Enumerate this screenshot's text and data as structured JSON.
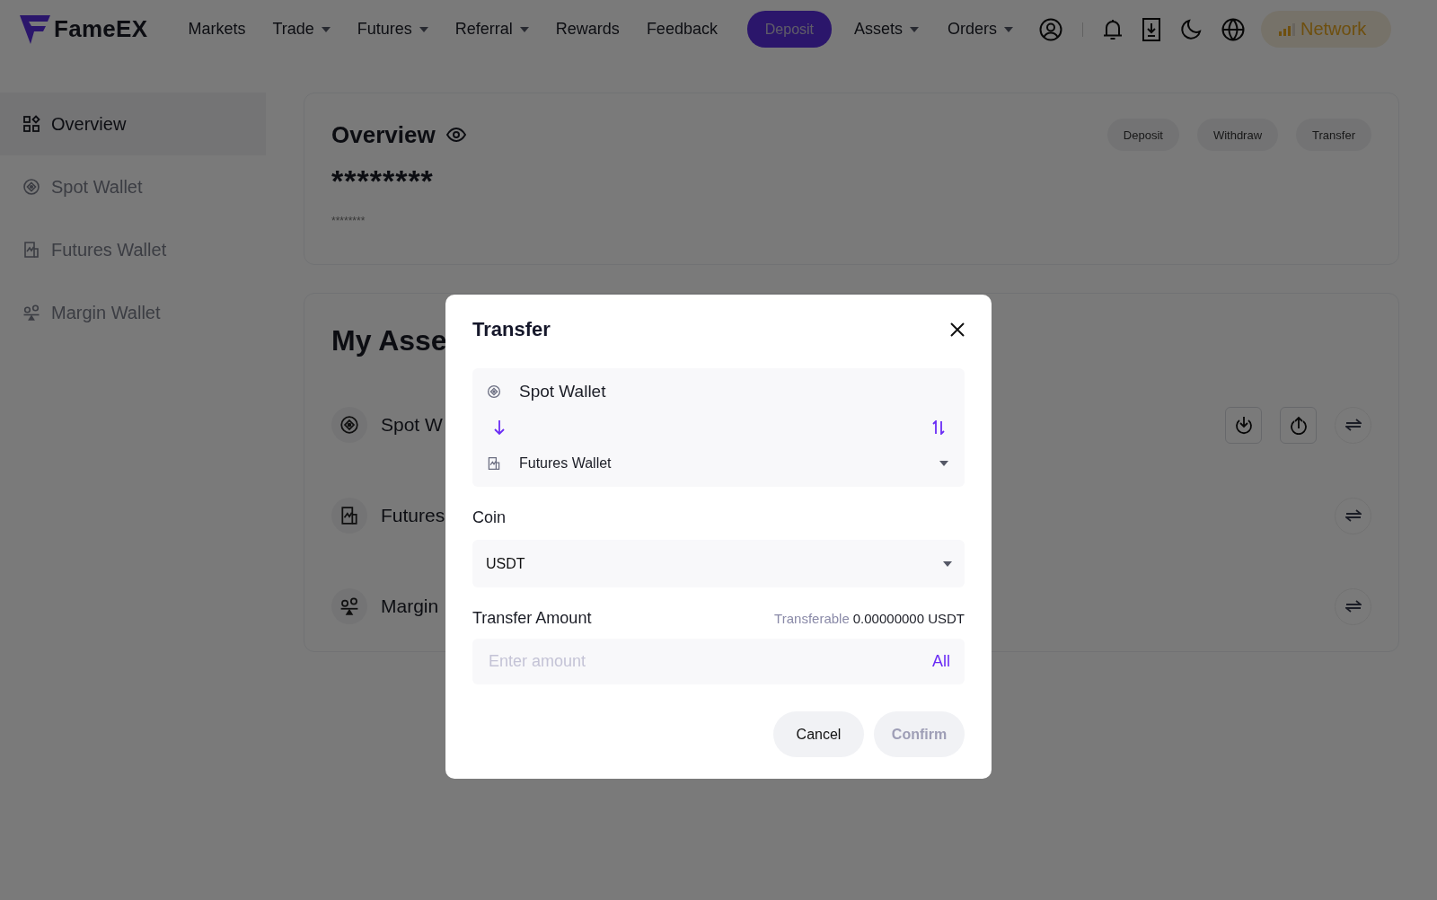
{
  "header": {
    "logo": "FameEX",
    "nav": [
      {
        "label": "Markets",
        "dropdown": false
      },
      {
        "label": "Trade",
        "dropdown": true
      },
      {
        "label": "Futures",
        "dropdown": true
      },
      {
        "label": "Referral",
        "dropdown": true
      },
      {
        "label": "Rewards",
        "dropdown": false
      },
      {
        "label": "Feedback",
        "dropdown": false
      }
    ],
    "deposit_button": "Deposit",
    "menus": [
      {
        "label": "Assets",
        "dropdown": true
      },
      {
        "label": "Orders",
        "dropdown": true
      }
    ],
    "network": "Network"
  },
  "sidebar": {
    "items": [
      {
        "label": "Overview",
        "kind": "grid",
        "selected": true
      },
      {
        "label": "Spot Wallet",
        "kind": "spot",
        "selected": false
      },
      {
        "label": "Futures Wallet",
        "kind": "futures",
        "selected": false
      },
      {
        "label": "Margin Wallet",
        "kind": "margin",
        "selected": false
      }
    ]
  },
  "overview": {
    "title": "Overview",
    "balance": "********",
    "sub_balance": "********",
    "buttons": [
      "Deposit",
      "Withdraw",
      "Transfer"
    ]
  },
  "assets": {
    "title": "My Asse",
    "rows": [
      {
        "kind": "spot",
        "name": "Spot W",
        "actions": [
          {
            "kind": "deposit"
          },
          {
            "kind": "withdraw"
          },
          {
            "kind": "transfer"
          }
        ]
      },
      {
        "kind": "futures",
        "name": "Futures",
        "actions": [
          {
            "kind": "transfer"
          }
        ]
      },
      {
        "kind": "margin",
        "name": "Margin",
        "actions": [
          {
            "kind": "transfer"
          }
        ]
      }
    ]
  },
  "dialog": {
    "title": "Transfer",
    "from": {
      "kind": "spot",
      "label": "Spot Wallet"
    },
    "to": {
      "kind": "futures",
      "label": "Futures Wallet"
    },
    "coin_label": "Coin",
    "coin": "USDT",
    "amount_label": "Transfer Amount",
    "transferable_label": "Transferable",
    "transferable_value": "0.00000000 USDT",
    "amount_placeholder": "Enter amount",
    "all_link": "All",
    "cancel": {
      "label": "Cancel",
      "disabled": false
    },
    "confirm": {
      "label": "Confirm",
      "disabled": true
    }
  }
}
